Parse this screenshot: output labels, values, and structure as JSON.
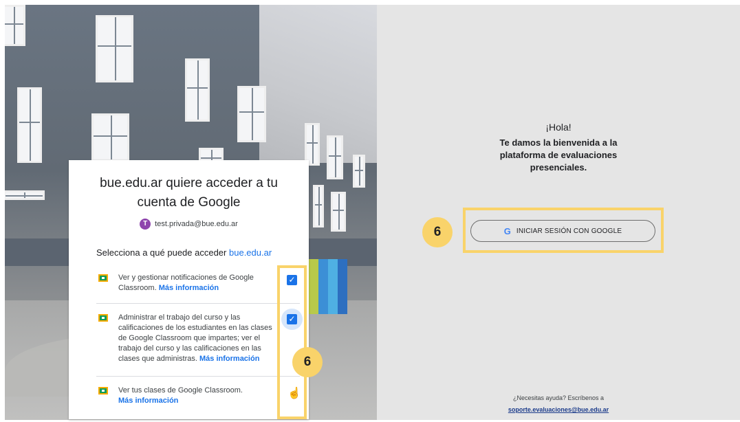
{
  "dialog": {
    "title_line1": "bue.edu.ar quiere acceder a tu",
    "title_line2": "cuenta de Google",
    "account": {
      "avatar_letter": "T",
      "email": "test.privada@bue.edu.ar"
    },
    "select_prefix": "Selecciona a qué puede acceder",
    "select_domain": "bue.edu.ar",
    "permissions": [
      {
        "line1": "Ver y gestionar notificaciones de Google",
        "line2": "Classroom.",
        "link": "Más información",
        "checked": true
      },
      {
        "line1": "Administrar el trabajo del curso y las",
        "line2": "calificaciones de los estudiantes en las clases",
        "line3": "de Google Classroom que impartes; ver el",
        "line4": "trabajo del curso y las calificaciones en las",
        "line5": "clases que administras.",
        "link": "Más información",
        "checked": true
      },
      {
        "line1": "Ver tus clases de Google Classroom.",
        "link": "Más información",
        "checked": false
      }
    ],
    "check_glyph": "✓",
    "hand_glyph": "☝"
  },
  "annotations": {
    "badge_left": "6",
    "badge_right": "6",
    "highlight_color": "#f9d36a"
  },
  "login_panel": {
    "greeting": "¡Hola!",
    "welcome_line1": "Te damos la bienvenida a la",
    "welcome_line2": "plataforma de evaluaciones",
    "welcome_line3": "presenciales.",
    "google_button_icon": "G",
    "google_button_label": "INICIAR SESIÓN CON GOOGLE",
    "help_text": "¿Necesitas ayuda? Escríbenos a",
    "help_email": "soporte.evaluaciones@bue.edu.ar"
  },
  "colors": {
    "panel_bg": "#e5e5e5",
    "link_blue": "#1a73e8",
    "checkbox_blue": "#1a73e8",
    "classroom_green": "#0f9d58",
    "avatar_purple": "#8e44ad"
  }
}
